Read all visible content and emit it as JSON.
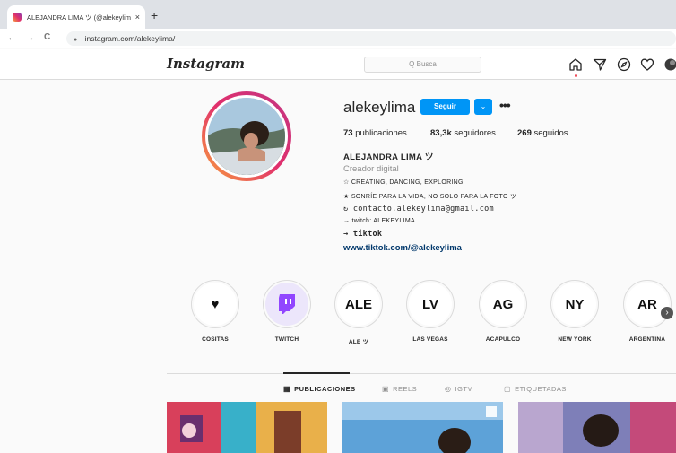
{
  "browser": {
    "tab_title": "ALEJANDRA LIMA ツ (@alekeylim",
    "tab_close": "×",
    "new_tab": "+",
    "back": "←",
    "forward": "→",
    "reload": "C",
    "url": "instagram.com/alekeylima/"
  },
  "header": {
    "logo": "Instagram",
    "search_placeholder": "Q Busca"
  },
  "profile": {
    "username": "alekeylima",
    "follow_label": "Seguir",
    "dropdown_label": "⌄",
    "more_label": "•••",
    "stats": {
      "posts_count": "73",
      "posts_label": "publicaciones",
      "followers_count": "83,3k",
      "followers_label": "seguidores",
      "following_count": "269",
      "following_label": "seguidos"
    },
    "full_name": "ALEJANDRA LIMA ツ",
    "category": "Creador digital",
    "bio": [
      "☆ CREATING, DANCING, EXPLORING",
      "★ SONRÍE PARA LA VIDA, NO SOLO PARA LA FOTO ツ",
      "↻ contacto.alekeylima@gmail.com",
      "→ twitch: ALEKEYLIMA",
      "→ tiktok"
    ],
    "link": "www.tiktok.com/@alekeylima"
  },
  "highlights": [
    {
      "label": "COSITAS",
      "content": "♥"
    },
    {
      "label": "TWITCH",
      "content": "■"
    },
    {
      "label": "ALE ツ",
      "content": "ALE"
    },
    {
      "label": "LAS VEGAS",
      "content": "LV"
    },
    {
      "label": "ACAPULCO",
      "content": "AG"
    },
    {
      "label": "NEW YORK",
      "content": "NY"
    },
    {
      "label": "ARGENTINA",
      "content": "AR"
    }
  ],
  "highlights_next": "›",
  "tabs": [
    {
      "icon": "▦",
      "label": "PUBLICACIONES"
    },
    {
      "icon": "▣",
      "label": "REELS"
    },
    {
      "icon": "◎",
      "label": "IGTV"
    },
    {
      "icon": "▢",
      "label": "ETIQUETADAS"
    }
  ],
  "colors": {
    "accent": "#0095f6",
    "link": "#00376b",
    "twitch": "#9146ff"
  }
}
